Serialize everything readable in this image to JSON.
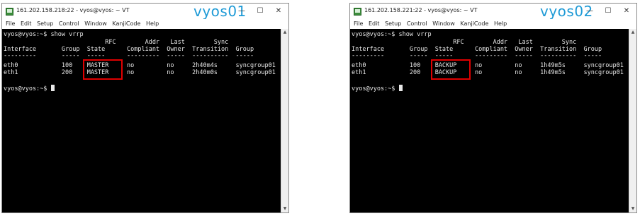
{
  "windows": [
    {
      "title": "161.202.158.218:22 - vyos@vyos: ~ VT",
      "host_label": "vyos01",
      "menu": [
        "File",
        "Edit",
        "Setup",
        "Control",
        "Window",
        "KanjiCode",
        "Help"
      ],
      "prompt_cmd": "vyos@vyos:~$ show vrrp",
      "header1": "                            RFC        Addr   Last        Sync",
      "header2": "Interface       Group  State      Compliant  Owner  Transition  Group",
      "sep": "---------       -----  -----      ---------  -----  ----------  -----",
      "row1": "eth0            100    MASTER     no         no     2h40m4s     syncgroup01",
      "row2": "eth1            200    MASTER     no         no     2h40m0s     syncgroup01",
      "prompt": "vyos@vyos:~$ "
    },
    {
      "title": "161.202.158.221:22 - vyos@vyos: ~ VT",
      "host_label": "vyos02",
      "menu": [
        "File",
        "Edit",
        "Setup",
        "Control",
        "Window",
        "KanjiCode",
        "Help"
      ],
      "prompt_cmd": "vyos@vyos:~$ show vrrp",
      "header1": "                            RFC        Addr   Last        Sync",
      "header2": "Interface       Group  State      Compliant  Owner  Transition  Group",
      "sep": "---------       -----  -----      ---------  -----  ----------  -----",
      "row1": "eth0            100    BACKUP     no         no     1h49m5s     syncgroup01",
      "row2": "eth1            200    BACKUP     no         no     1h49m5s     syncgroup01",
      "prompt": "vyos@vyos:~$ "
    }
  ],
  "controls": {
    "minimize": "—",
    "maximize": "☐",
    "close": "✕"
  },
  "scroll": {
    "up": "▲",
    "down": "▼"
  },
  "colors": {
    "highlight": "#e00000",
    "host_label": "#1e9ad6",
    "terminal_bg": "#000000"
  },
  "icons": {
    "app": "terminal-app-icon"
  }
}
